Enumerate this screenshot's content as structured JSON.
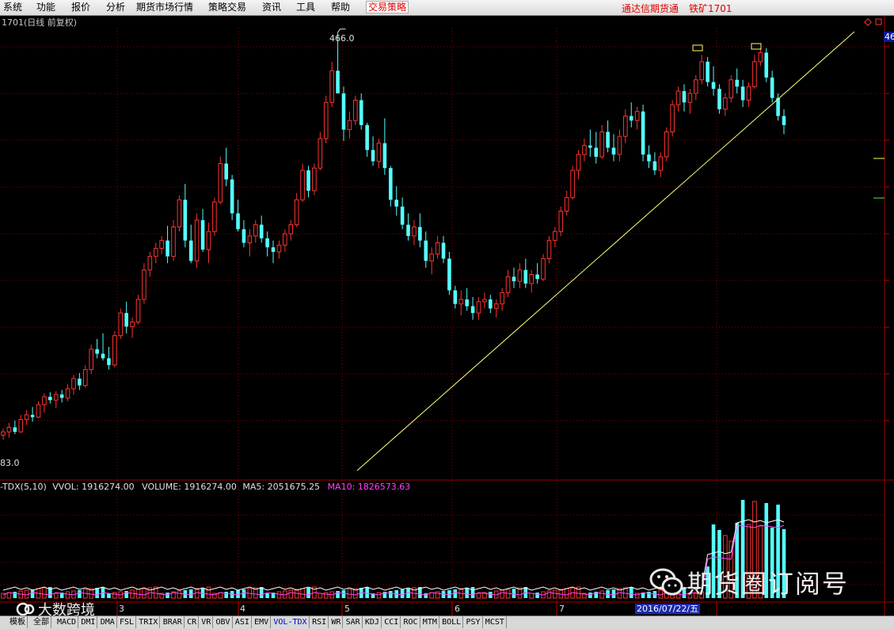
{
  "menu": {
    "items": [
      "系统",
      "功能",
      "报价",
      "分析",
      "期货市场行情",
      "策略交易",
      "资讯",
      "工具",
      "帮助"
    ],
    "highlight": "交易策略",
    "right_app": "通达信期货通",
    "right_symbol": "铁矿1701"
  },
  "chart_header": "1701(日线 前复权)",
  "price_high_label": "466.0",
  "price_low_label": "83.0",
  "right_axis_label": "46",
  "indicator_line": {
    "name": "-TDX(5,10)",
    "vvol": "VVOL: 1916274.00",
    "volume": "VOLUME: 1916274.00",
    "ma5": "MA5: 2051675.25",
    "ma10": "MA10: 1826573.63"
  },
  "month_labels": [
    "3",
    "4",
    "5",
    "6",
    "7"
  ],
  "date_tag": "2016/07/22/五",
  "bottom_tabs": [
    "模板",
    "全部",
    "MACD",
    "DMI",
    "DMA",
    "FSL",
    "TRIX",
    "BRAR",
    "CR",
    "VR",
    "OBV",
    "ASI",
    "EMV",
    "VOL-TDX",
    "RSI",
    "WR",
    "SAR",
    "KDJ",
    "CCI",
    "ROC",
    "MTM",
    "BOLL",
    "PSY",
    "MCST"
  ],
  "active_tab": "VOL-TDX",
  "watermark_right": "期货圈订阅号",
  "watermark_left": "大数跨境",
  "colors": {
    "up": "#ff3232",
    "down": "#54ffff",
    "grid": "#8b0000",
    "trendline": "#ffff7a",
    "ma5": "#ffffff",
    "ma10": "#ff44ff"
  },
  "chart_data": {
    "type": "candlestick",
    "ylim": [
      83.0,
      470.0
    ],
    "candles": [
      [
        110,
        116,
        106,
        113
      ],
      [
        113,
        121,
        108,
        117
      ],
      [
        117,
        123,
        111,
        113
      ],
      [
        113,
        128,
        112,
        124
      ],
      [
        124,
        132,
        119,
        128
      ],
      [
        128,
        135,
        122,
        126
      ],
      [
        126,
        140,
        125,
        137
      ],
      [
        137,
        147,
        130,
        144
      ],
      [
        144,
        148,
        138,
        141
      ],
      [
        141,
        149,
        134,
        146
      ],
      [
        146,
        150,
        139,
        143
      ],
      [
        143,
        155,
        140,
        151
      ],
      [
        151,
        163,
        146,
        160
      ],
      [
        160,
        165,
        150,
        154
      ],
      [
        154,
        172,
        152,
        168
      ],
      [
        168,
        190,
        164,
        186
      ],
      [
        186,
        195,
        178,
        182
      ],
      [
        182,
        200,
        176,
        178
      ],
      [
        178,
        188,
        168,
        172
      ],
      [
        172,
        202,
        170,
        198
      ],
      [
        198,
        222,
        195,
        218
      ],
      [
        218,
        228,
        200,
        206
      ],
      [
        206,
        214,
        196,
        210
      ],
      [
        210,
        234,
        208,
        230
      ],
      [
        230,
        262,
        226,
        256
      ],
      [
        256,
        272,
        250,
        268
      ],
      [
        268,
        280,
        262,
        275
      ],
      [
        275,
        286,
        270,
        282
      ],
      [
        282,
        295,
        262,
        268
      ],
      [
        268,
        300,
        264,
        294
      ],
      [
        294,
        322,
        290,
        318
      ],
      [
        318,
        332,
        276,
        282
      ],
      [
        282,
        296,
        262,
        264
      ],
      [
        264,
        306,
        258,
        300
      ],
      [
        300,
        310,
        272,
        274
      ],
      [
        274,
        298,
        262,
        290
      ],
      [
        290,
        320,
        286,
        316
      ],
      [
        316,
        356,
        314,
        350
      ],
      [
        350,
        364,
        330,
        336
      ],
      [
        336,
        340,
        300,
        306
      ],
      [
        306,
        318,
        290,
        292
      ],
      [
        292,
        300,
        276,
        280
      ],
      [
        280,
        292,
        268,
        286
      ],
      [
        286,
        300,
        280,
        296
      ],
      [
        296,
        304,
        280,
        284
      ],
      [
        284,
        290,
        268,
        276
      ],
      [
        276,
        282,
        262,
        272
      ],
      [
        272,
        282,
        266,
        278
      ],
      [
        278,
        292,
        272,
        288
      ],
      [
        288,
        300,
        282,
        296
      ],
      [
        296,
        324,
        294,
        318
      ],
      [
        318,
        350,
        316,
        344
      ],
      [
        344,
        348,
        320,
        326
      ],
      [
        326,
        350,
        322,
        346
      ],
      [
        346,
        378,
        344,
        372
      ],
      [
        372,
        410,
        368,
        404
      ],
      [
        404,
        440,
        400,
        432
      ],
      [
        432,
        466,
        430,
        412
      ],
      [
        412,
        418,
        370,
        380
      ],
      [
        380,
        396,
        372,
        388
      ],
      [
        388,
        410,
        384,
        406
      ],
      [
        406,
        412,
        380,
        384
      ],
      [
        384,
        386,
        356,
        362
      ],
      [
        362,
        374,
        348,
        352
      ],
      [
        352,
        372,
        346,
        368
      ],
      [
        368,
        390,
        340,
        346
      ],
      [
        346,
        348,
        312,
        318
      ],
      [
        318,
        330,
        304,
        312
      ],
      [
        312,
        320,
        292,
        296
      ],
      [
        296,
        306,
        282,
        286
      ],
      [
        286,
        300,
        278,
        294
      ],
      [
        294,
        306,
        276,
        282
      ],
      [
        282,
        290,
        258,
        264
      ],
      [
        264,
        276,
        252,
        270
      ],
      [
        270,
        286,
        266,
        280
      ],
      [
        280,
        286,
        262,
        266
      ],
      [
        266,
        272,
        234,
        238
      ],
      [
        238,
        242,
        222,
        226
      ],
      [
        226,
        238,
        216,
        230
      ],
      [
        230,
        240,
        220,
        224
      ],
      [
        224,
        232,
        212,
        218
      ],
      [
        218,
        232,
        212,
        228
      ],
      [
        228,
        236,
        222,
        230
      ],
      [
        230,
        234,
        218,
        222
      ],
      [
        222,
        230,
        214,
        226
      ],
      [
        226,
        240,
        220,
        236
      ],
      [
        236,
        256,
        232,
        250
      ],
      [
        250,
        258,
        240,
        246
      ],
      [
        246,
        262,
        240,
        256
      ],
      [
        256,
        266,
        240,
        244
      ],
      [
        244,
        256,
        236,
        252
      ],
      [
        252,
        262,
        244,
        248
      ],
      [
        248,
        270,
        246,
        266
      ],
      [
        266,
        286,
        262,
        282
      ],
      [
        282,
        294,
        276,
        290
      ],
      [
        290,
        312,
        286,
        308
      ],
      [
        308,
        326,
        304,
        320
      ],
      [
        320,
        348,
        318,
        344
      ],
      [
        344,
        362,
        336,
        358
      ],
      [
        358,
        372,
        352,
        366
      ],
      [
        366,
        380,
        356,
        364
      ],
      [
        364,
        378,
        350,
        356
      ],
      [
        356,
        384,
        354,
        378
      ],
      [
        378,
        388,
        360,
        364
      ],
      [
        364,
        376,
        352,
        358
      ],
      [
        358,
        380,
        352,
        374
      ],
      [
        374,
        398,
        368,
        392
      ],
      [
        392,
        404,
        382,
        388
      ],
      [
        388,
        400,
        380,
        396
      ],
      [
        396,
        402,
        352,
        358
      ],
      [
        358,
        366,
        346,
        352
      ],
      [
        352,
        360,
        340,
        344
      ],
      [
        344,
        360,
        338,
        356
      ],
      [
        356,
        382,
        352,
        378
      ],
      [
        378,
        406,
        374,
        402
      ],
      [
        402,
        418,
        396,
        414
      ],
      [
        414,
        420,
        396,
        404
      ],
      [
        404,
        416,
        394,
        412
      ],
      [
        412,
        428,
        406,
        424
      ],
      [
        424,
        446,
        420,
        440
      ],
      [
        440,
        444,
        418,
        422
      ],
      [
        422,
        436,
        410,
        416
      ],
      [
        416,
        420,
        394,
        398
      ],
      [
        398,
        412,
        392,
        408
      ],
      [
        408,
        428,
        404,
        424
      ],
      [
        424,
        434,
        412,
        418
      ],
      [
        418,
        424,
        400,
        406
      ],
      [
        406,
        422,
        400,
        418
      ],
      [
        418,
        446,
        416,
        440
      ],
      [
        440,
        452,
        436,
        448
      ],
      [
        448,
        452,
        422,
        426
      ],
      [
        426,
        432,
        404,
        408
      ],
      [
        408,
        412,
        388,
        392
      ],
      [
        392,
        398,
        376,
        384
      ]
    ],
    "volume_ma": {
      "ma5": 2051675.25,
      "ma10": 1826573.63,
      "last_volume": 1916274.0
    }
  }
}
